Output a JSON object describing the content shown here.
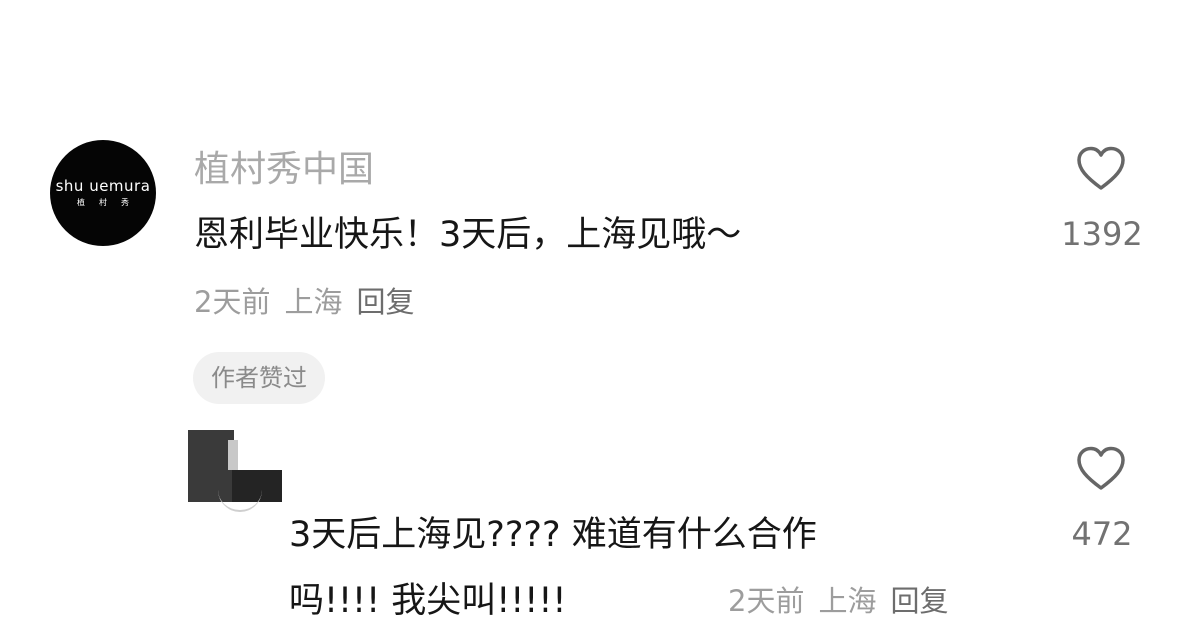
{
  "comment": {
    "avatar": {
      "brand": "shu uemura",
      "brand_sub": "植村秀"
    },
    "username": "植村秀中国",
    "text": "恩利毕业快乐！3天后，上海见哦～",
    "time": "2天前",
    "location": "上海",
    "reply_label": "回复",
    "badge": "作者赞过",
    "like_count": "1392",
    "like_icon": "heart-outline-icon"
  },
  "reply": {
    "text_line1": "3天后上海见????  难道有什么合作",
    "text_line2": "吗!!!!  我尖叫!!!!!",
    "time": "2天前",
    "location": "上海",
    "reply_label": "回复",
    "like_count": "472",
    "like_icon": "heart-outline-icon"
  }
}
